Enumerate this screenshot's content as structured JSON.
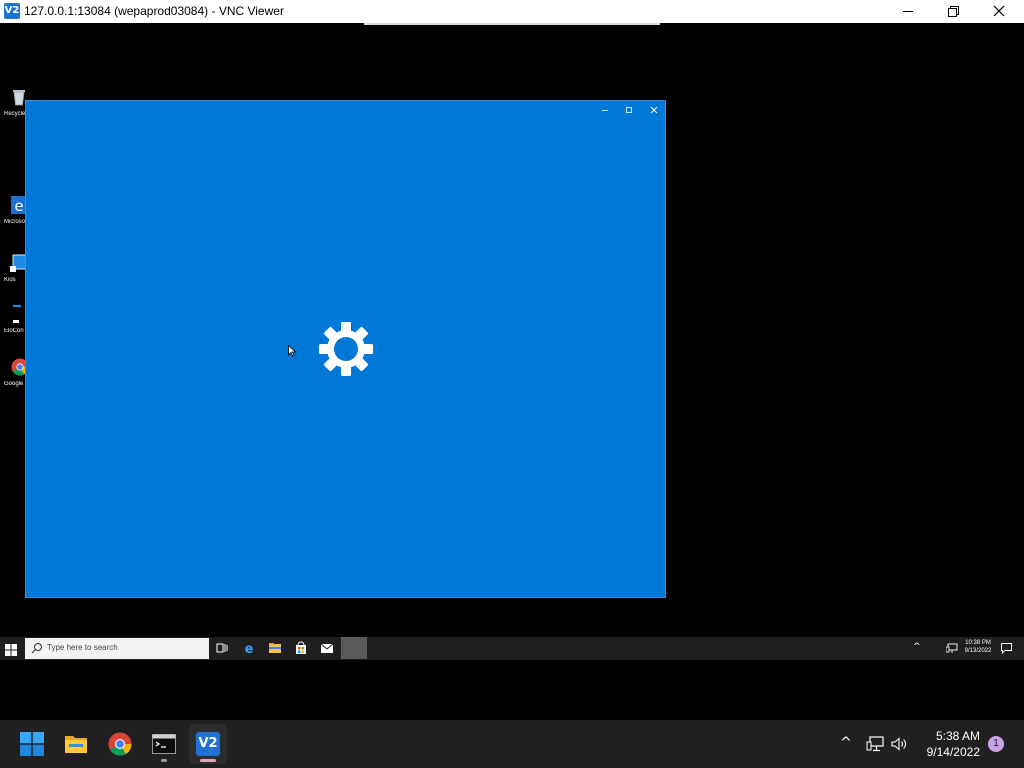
{
  "vnc_window": {
    "logo_text": "V2",
    "title": "127.0.0.1:13084 (wepaprod03084) - VNC Viewer",
    "icon_minimize": "minimize-icon",
    "icon_restore": "restore-icon",
    "icon_close": "close-icon"
  },
  "desktop": {
    "icons": [
      {
        "label": "Recycle",
        "icon": "recycle-bin-icon"
      },
      {
        "label": "Microsoft Edge",
        "icon": "edge-icon"
      },
      {
        "label": "Kios",
        "icon": "kiosk-app-icon"
      },
      {
        "label": "EloCon",
        "icon": "elo-config-icon"
      },
      {
        "label": "Google Chrome",
        "icon": "chrome-icon"
      }
    ]
  },
  "settings_app": {
    "icon": "gear-icon",
    "background_color": "#0078d7"
  },
  "inner_taskbar": {
    "search_placeholder": "Type here to search",
    "clock_time": "10:38 PM",
    "clock_date": "9/13/2022"
  },
  "host_taskbar": {
    "apps": [
      "start-icon",
      "file-explorer-icon",
      "chrome-icon",
      "terminal-icon",
      "vnc-viewer-icon"
    ],
    "vnc_logo_text": "V2",
    "time": "5:38 AM",
    "date": "9/14/2022",
    "notification_count": "1"
  },
  "colors": {
    "accent": "#0078d7",
    "vnc_brand": "#1e73d2",
    "host_taskbar": "#202020",
    "notification_badge": "#c8a2e8"
  }
}
